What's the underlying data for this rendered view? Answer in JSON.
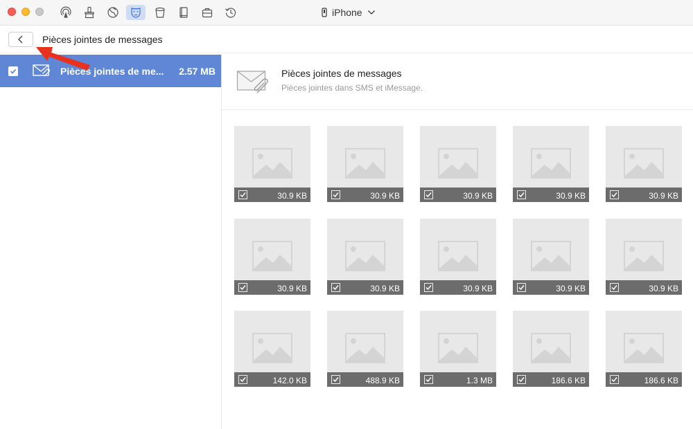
{
  "device": {
    "name": "iPhone"
  },
  "toolbar": {
    "icons": [
      "airdrop-icon",
      "cleaner-icon",
      "browser-icon",
      "privacy-mask-icon",
      "trash-icon",
      "book-icon",
      "briefcase-icon",
      "history-icon"
    ],
    "active_icon": "privacy-mask-icon"
  },
  "subheader": {
    "title": "Pièces jointes de messages"
  },
  "sidebar": {
    "items": [
      {
        "label": "Pièces jointes de me...",
        "size": "2.57 MB",
        "checked": true
      }
    ]
  },
  "main": {
    "title": "Pièces jointes de messages",
    "subtitle": "Pièces jointes dans SMS et iMessage."
  },
  "attachments": [
    {
      "size": "30.9 KB",
      "checked": true
    },
    {
      "size": "30.9 KB",
      "checked": true
    },
    {
      "size": "30.9 KB",
      "checked": true
    },
    {
      "size": "30.9 KB",
      "checked": true
    },
    {
      "size": "30.9 KB",
      "checked": true
    },
    {
      "size": "30.9 KB",
      "checked": true
    },
    {
      "size": "30.9 KB",
      "checked": true
    },
    {
      "size": "30.9 KB",
      "checked": true
    },
    {
      "size": "30.9 KB",
      "checked": true
    },
    {
      "size": "30.9 KB",
      "checked": true
    },
    {
      "size": "142.0 KB",
      "checked": true
    },
    {
      "size": "488.9 KB",
      "checked": true
    },
    {
      "size": "1.3 MB",
      "checked": true
    },
    {
      "size": "186.6 KB",
      "checked": true
    },
    {
      "size": "186.6 KB",
      "checked": true
    }
  ],
  "colors": {
    "accent": "#5f87d6",
    "tile_bg": "#e8e8e8",
    "tile_bar": "#6c6c6c",
    "annotation_arrow": "#e8321e"
  }
}
